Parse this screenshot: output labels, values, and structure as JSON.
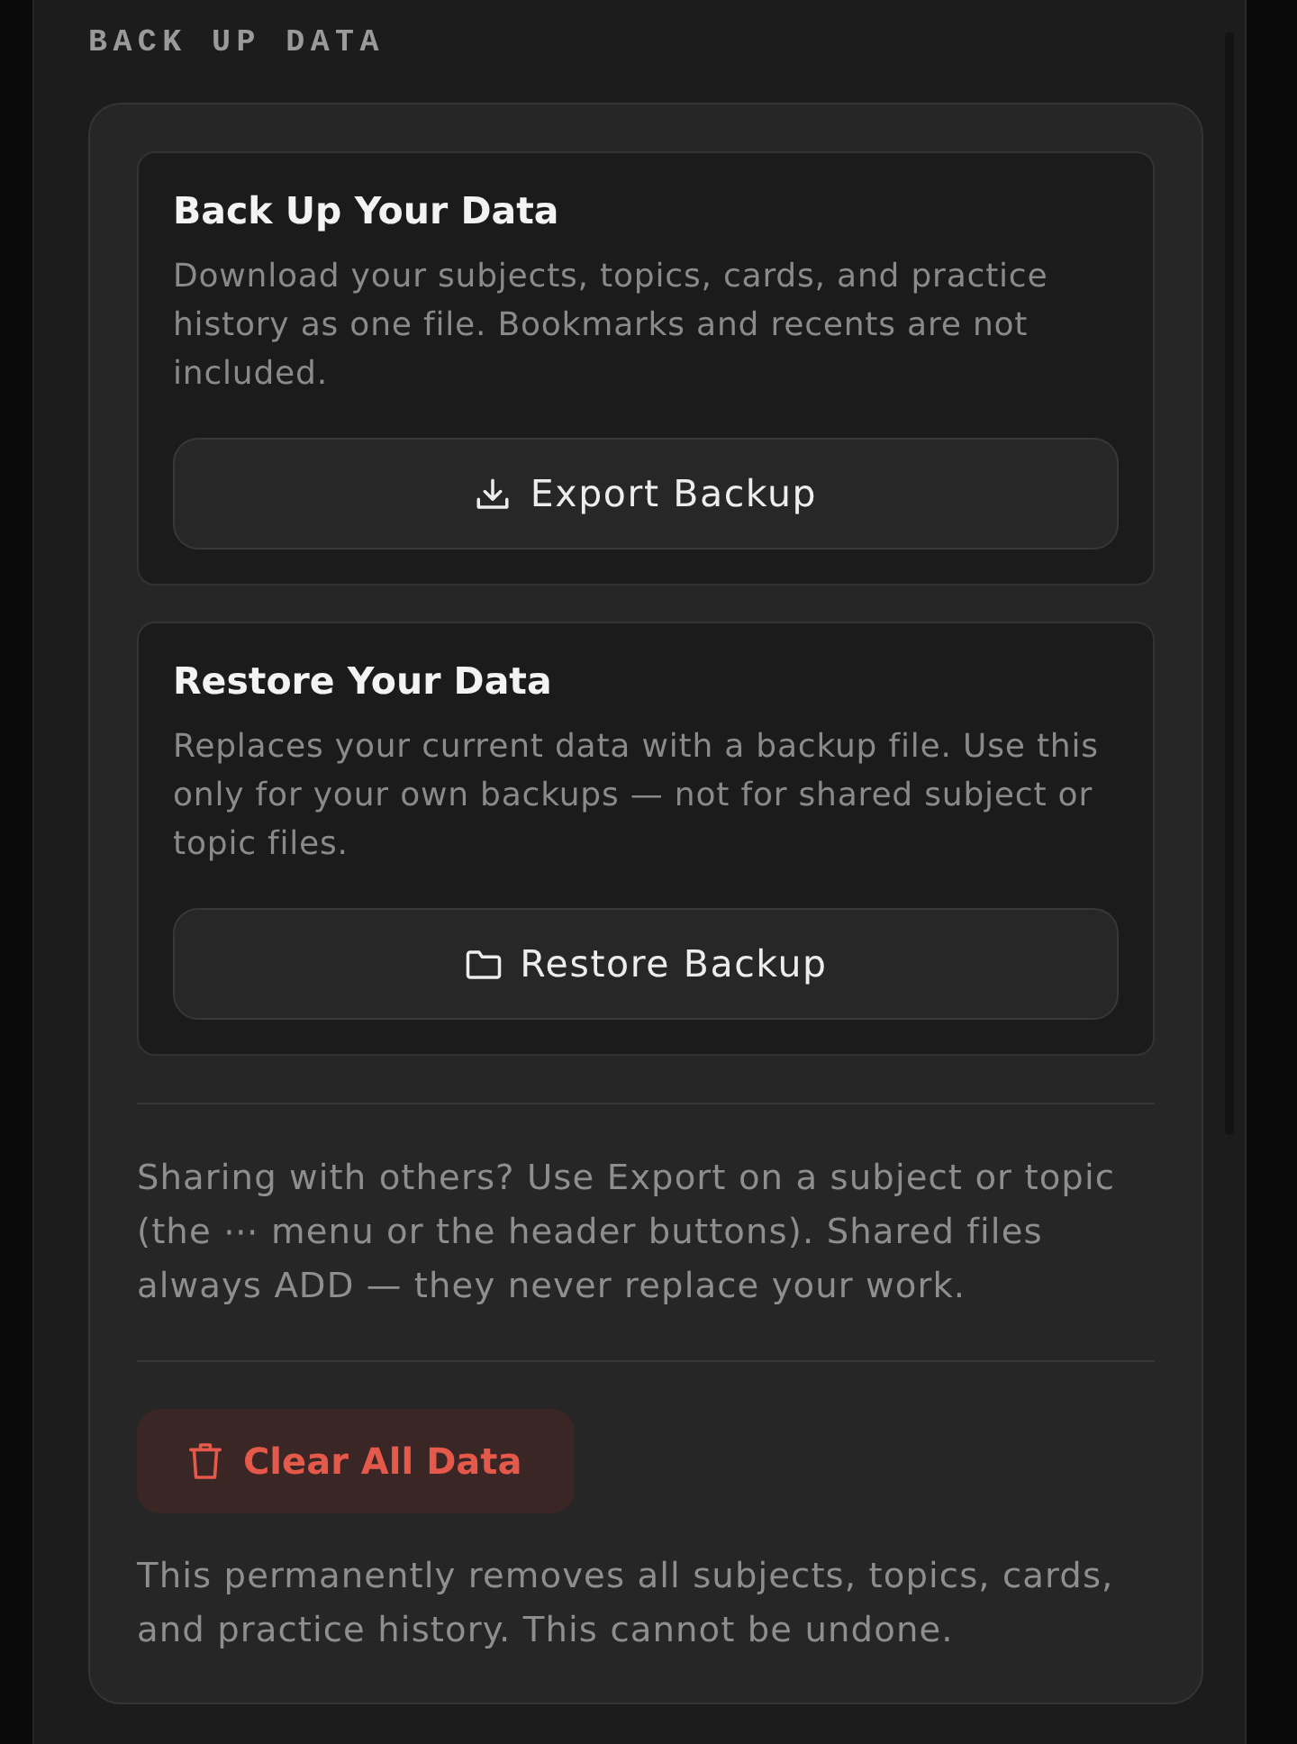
{
  "section": {
    "heading": "BACK UP DATA"
  },
  "cards": [
    {
      "kind": "export",
      "title": "Back Up Your Data",
      "description": "Download your subjects, topics, cards, and practice history as one file. Bookmarks and recents are not included.",
      "button": "Export Backup"
    },
    {
      "kind": "restore",
      "title": "Restore Your Data",
      "description": "Replaces your current data with a backup file. Use this only for your own backups — not for shared subject or topic files.",
      "button": "Restore Backup"
    }
  ],
  "sharing_note": "Sharing with others? Use Export on a subject or topic (the ⋯ menu or the header buttons). Shared files always ADD — they never replace your work.",
  "danger": {
    "button": "Clear All Data",
    "warning": "This permanently removes all subjects, topics, cards, and practice history. This cannot be undone."
  }
}
